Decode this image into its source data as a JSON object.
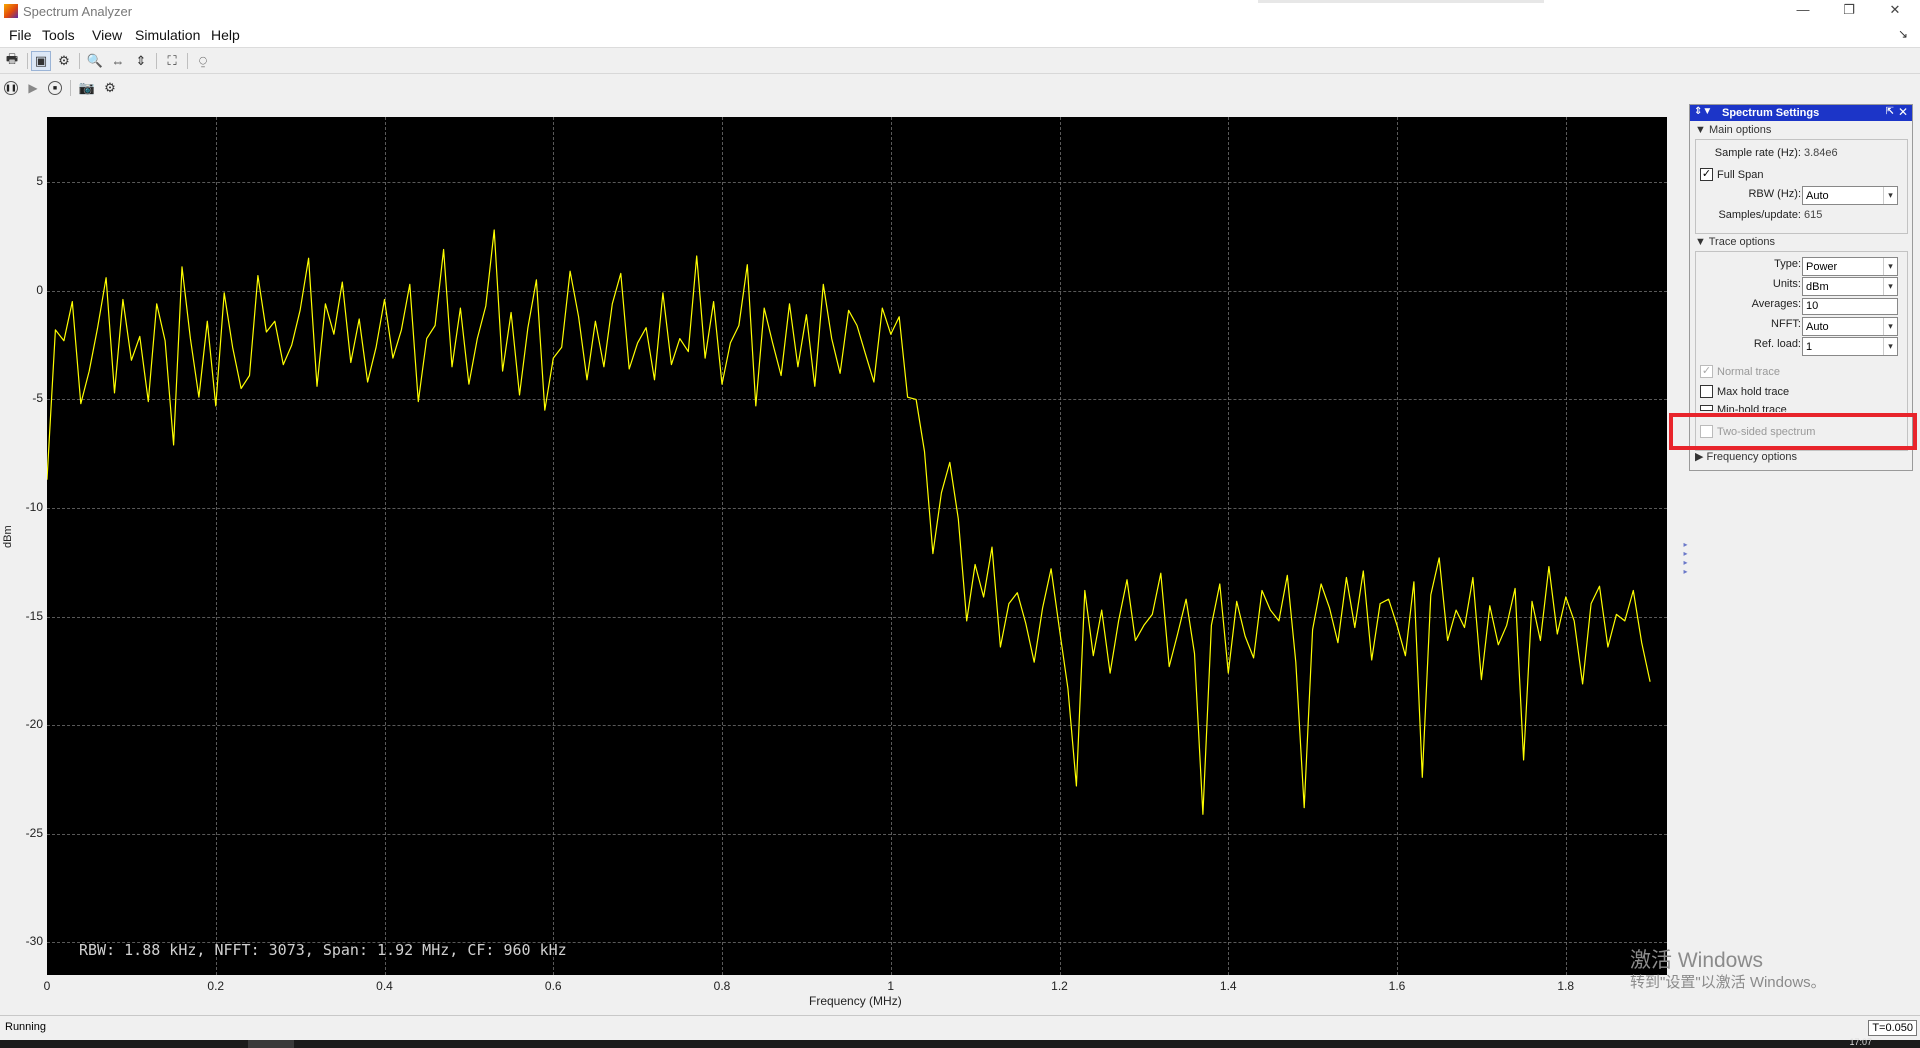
{
  "window": {
    "title": "Spectrum Analyzer",
    "minimize": "—",
    "restore": "❐",
    "close": "✕"
  },
  "menu": [
    "File",
    "Tools",
    "View",
    "Simulation",
    "Help"
  ],
  "menu_corner": "↘",
  "toolbar": {
    "print": "🖶",
    "toggle": "▣",
    "settings": "⚙",
    "zoom_in": "🔍",
    "zoom_x": "⇔",
    "zoom_y": "⇕",
    "autoscale": "⛶",
    "measure": "⍜"
  },
  "sim_toolbar": {
    "pause": "❚❚",
    "step": "▶",
    "stop": "■",
    "snapshot": "📷",
    "highlight": "⚙"
  },
  "plot": {
    "readout": "RBW: 1.88 kHz, NFFT: 3073, Span: 1.92 MHz, CF: 960 kHz",
    "ylabel": "dBm",
    "xlabel": "Frequency (MHz)",
    "yticks": [
      "5",
      "0",
      "-5",
      "-10",
      "-15",
      "-20",
      "-25",
      "-30"
    ],
    "xticks": [
      "0",
      "0.2",
      "0.4",
      "0.6",
      "0.8",
      "1",
      "1.2",
      "1.4",
      "1.6",
      "1.8"
    ]
  },
  "chart_data": {
    "type": "line",
    "xlabel": "Frequency (MHz)",
    "ylabel": "dBm",
    "xlim": [
      0,
      1.92
    ],
    "ylim": [
      -31.5,
      8
    ],
    "grid": true,
    "series": [
      {
        "color": "#ffff00",
        "x_start": 0,
        "x_end": 1.92,
        "x_step": 0.01,
        "values": [
          -8.7,
          -1.8,
          -2.3,
          -0.5,
          -5.2,
          -3.7,
          -1.7,
          0.6,
          -4.7,
          -0.4,
          -3.2,
          -2.1,
          -5.1,
          -0.6,
          -2.3,
          -7.1,
          1.1,
          -2.2,
          -4.9,
          -1.4,
          -5.3,
          -0.1,
          -2.6,
          -4.5,
          -3.9,
          0.7,
          -1.9,
          -1.4,
          -3.4,
          -2.5,
          -0.9,
          1.5,
          -4.4,
          -0.6,
          -2.0,
          0.4,
          -3.3,
          -1.3,
          -4.2,
          -2.6,
          -0.4,
          -3.1,
          -1.8,
          0.3,
          -5.1,
          -2.2,
          -1.6,
          1.9,
          -3.5,
          -0.8,
          -4.3,
          -2.2,
          -0.7,
          2.8,
          -3.7,
          -1.0,
          -4.8,
          -1.7,
          0.5,
          -5.5,
          -3.1,
          -2.6,
          0.9,
          -1.2,
          -4.1,
          -1.4,
          -3.5,
          -0.6,
          0.8,
          -3.6,
          -2.4,
          -1.7,
          -4.1,
          -0.1,
          -3.4,
          -2.2,
          -2.8,
          1.6,
          -3.1,
          -0.5,
          -4.3,
          -2.4,
          -1.6,
          1.2,
          -5.3,
          -0.8,
          -2.4,
          -3.9,
          -0.6,
          -3.5,
          -1.1,
          -4.4,
          0.3,
          -2.2,
          -3.8,
          -0.9,
          -1.6,
          -2.9,
          -4.2,
          -0.8,
          -2.0,
          -1.2,
          -4.9,
          -5.0,
          -7.4,
          -12.1,
          -9.3,
          -7.9,
          -10.5,
          -15.2,
          -12.6,
          -14.1,
          -11.8,
          -16.4,
          -14.4,
          -13.9,
          -15.3,
          -17.1,
          -14.6,
          -12.8,
          -15.6,
          -18.3,
          -22.8,
          -13.8,
          -16.8,
          -14.7,
          -17.6,
          -15.2,
          -13.3,
          -16.1,
          -15.4,
          -14.9,
          -13.0,
          -17.3,
          -15.8,
          -14.2,
          -16.7,
          -24.1,
          -15.4,
          -13.5,
          -17.6,
          -14.3,
          -15.9,
          -16.9,
          -13.8,
          -14.7,
          -15.2,
          -13.1,
          -17.1,
          -23.8,
          -15.6,
          -13.5,
          -14.6,
          -16.2,
          -13.2,
          -15.5,
          -12.9,
          -17.0,
          -14.4,
          -14.2,
          -15.4,
          -16.8,
          -13.4,
          -22.4,
          -14.0,
          -12.3,
          -16.1,
          -14.7,
          -15.5,
          -13.2,
          -17.9,
          -14.5,
          -16.3,
          -15.4,
          -13.7,
          -21.6,
          -14.3,
          -16.1,
          -12.7,
          -15.8,
          -14.1,
          -15.2,
          -18.1,
          -14.4,
          -13.6,
          -16.4,
          -14.9,
          -15.2,
          -13.8,
          -16.2,
          -18.0
        ]
      }
    ]
  },
  "panel": {
    "title": "Spectrum Settings",
    "header_icons": "⇕▼",
    "pin": "⇱",
    "close": "✕",
    "main_options": "▼ Main options",
    "sample_rate_label": "Sample rate (Hz):",
    "sample_rate": "3.84e6",
    "full_span": "Full Span",
    "rbw_label": "RBW (Hz):",
    "rbw": "Auto",
    "samples_label": "Samples/update:",
    "samples": "615",
    "trace_options": "▼ Trace options",
    "type_label": "Type:",
    "type": "Power",
    "units_label": "Units:",
    "units": "dBm",
    "averages_label": "Averages:",
    "averages": "10",
    "nfft_label": "NFFT:",
    "nfft": "Auto",
    "refload_label": "Ref. load:",
    "refload": "1",
    "normal_trace": "Normal trace",
    "max_hold": "Max hold trace",
    "min_hold": "Min-hold trace",
    "two_sided": "Two-sided spectrum",
    "frequency_options": "▶ Frequency options",
    "check_mark": "✓",
    "combo_arrow": "▾"
  },
  "side_arrows": "▸▸▸▸",
  "watermark": {
    "line1": "激活 Windows",
    "line2": "转到\"设置\"以激活 Windows。"
  },
  "status": {
    "text": "Running",
    "time": "T=0.050"
  },
  "taskbar_clock": "17:07",
  "colors": {
    "trace": "#ffff00",
    "plot_bg": "#000000",
    "panel_header": "#1c35c8",
    "highlight": "#e8242b"
  }
}
